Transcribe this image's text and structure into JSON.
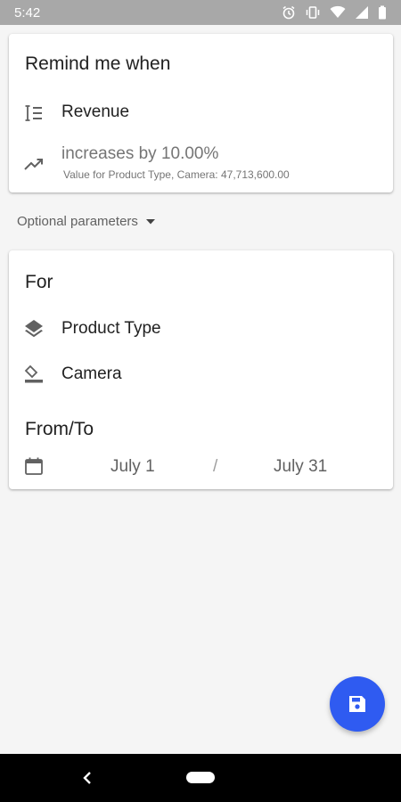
{
  "status_bar": {
    "time": "5:42"
  },
  "alert": {
    "title": "Remind me when",
    "metric": "Revenue",
    "condition": "increases by 10.00%",
    "condition_detail": "Value for Product Type, Camera: 47,713,600.00"
  },
  "optional_parameters": {
    "label": "Optional parameters"
  },
  "filters": {
    "title": "For",
    "dimension": "Product Type",
    "value": "Camera"
  },
  "date_range": {
    "title": "From/To",
    "from": "July 1",
    "separator": "/",
    "to": "July 31"
  },
  "colors": {
    "accent": "#2f5bf1",
    "status_bar": "#a8a8a8"
  },
  "icons": {
    "metric": "sort-lines-icon",
    "condition": "trending-up-icon",
    "dimension": "layers-icon",
    "value": "eraser-icon",
    "date": "calendar-icon",
    "fab": "save-icon"
  }
}
